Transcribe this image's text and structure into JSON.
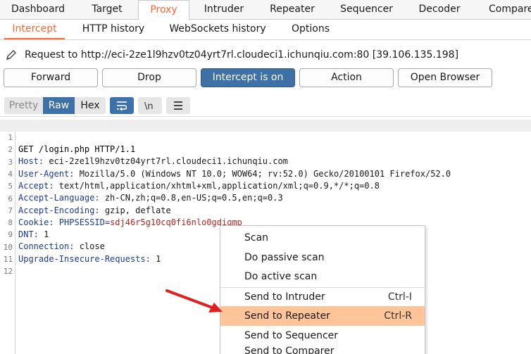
{
  "main_tabs": [
    "Dashboard",
    "Target",
    "Proxy",
    "Intruder",
    "Repeater",
    "Sequencer",
    "Decoder",
    "Compare"
  ],
  "sub_tabs": [
    "Intercept",
    "HTTP history",
    "WebSockets history",
    "Options"
  ],
  "request_line": "Request to http://eci-2ze1l9hzv0tz04yrt7rl.cloudeci1.ichunqiu.com:80  [39.106.135.198]",
  "buttons": {
    "forward": "Forward",
    "drop": "Drop",
    "intercept": "Intercept is on",
    "action": "Action",
    "open_browser": "Open Browser"
  },
  "view_modes": {
    "pretty": "Pretty",
    "raw": "Raw",
    "hex": "Hex"
  },
  "toolbar_icons": [
    "wrap-icon",
    "newline-icon",
    "menu-icon"
  ],
  "editor": {
    "line_numbers": [
      "1",
      "2",
      "3",
      "4",
      "5",
      "6",
      "7",
      "8",
      "9",
      "10",
      "11",
      "12"
    ],
    "request_line": "GET /login.php HTTP/1.1",
    "headers": [
      {
        "name": "Host:",
        "value": " eci-2ze1l9hzv0tz04yrt7rl.cloudeci1.ichunqiu.com"
      },
      {
        "name": "User-Agent:",
        "value": " Mozilla/5.0 (Windows NT 10.0; WOW64; rv:52.0) Gecko/20100101 Firefox/52.0"
      },
      {
        "name": "Accept:",
        "value": " text/html,application/xhtml+xml,application/xml;q=0.9,*/*;q=0.8"
      },
      {
        "name": "Accept-Language:",
        "value": " zh-CN,zh;q=0.8,en-US;q=0.5,en;q=0.3"
      },
      {
        "name": "Accept-Encoding:",
        "value": " gzip, deflate"
      }
    ],
    "cookie": {
      "name": "Cookie:",
      "key": " PHPSESSID=",
      "value": "sdj46r5g10cq0fi6nlo0gdigmp"
    },
    "headers_after": [
      {
        "name": "DNT:",
        "value": " 1"
      },
      {
        "name": "Connection:",
        "value": " close"
      },
      {
        "name": "Upgrade-Insecure-Requests:",
        "value": " 1"
      }
    ]
  },
  "context_menu": {
    "items": [
      {
        "label": "Scan",
        "shortcut": ""
      },
      {
        "label": "Do passive scan",
        "shortcut": ""
      },
      {
        "label": "Do active scan",
        "shortcut": ""
      },
      {
        "label": "Send to Intruder",
        "shortcut": "Ctrl-I"
      },
      {
        "label": "Send to Repeater",
        "shortcut": "Ctrl-R"
      },
      {
        "label": "Send to Sequencer",
        "shortcut": ""
      },
      {
        "label": "Send to Comparer",
        "shortcut": ""
      }
    ],
    "selected": "Send to Repeater"
  },
  "colors": {
    "accent_orange": "#ff6633",
    "primary_blue": "#3d71a8",
    "menu_highlight": "#ffc599",
    "annotation_arrow": "#e02020"
  }
}
